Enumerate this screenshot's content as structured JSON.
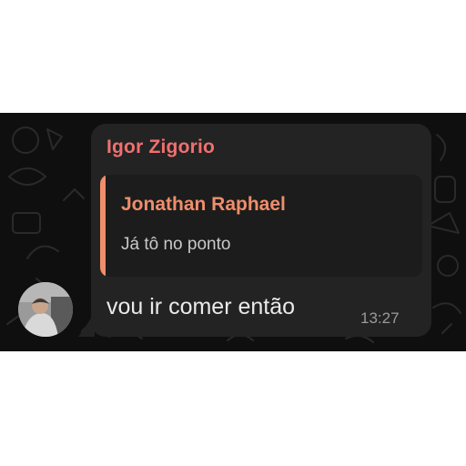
{
  "message": {
    "sender_name": "Igor Zigorio",
    "reply": {
      "author": "Jonathan Raphael",
      "text": "Já tô no ponto"
    },
    "text": "vou ir comer então",
    "time": "13:27"
  },
  "colors": {
    "chat_background": "#0f0f0f",
    "bubble": "#232323",
    "quote_background": "#1c1c1c",
    "sender_name": "#f07070",
    "reply_accent": "#ef8e6b",
    "message_text": "#eaeaea",
    "timestamp": "#9a9a9a"
  },
  "icons": {
    "avatar": "user-photo-avatar"
  }
}
